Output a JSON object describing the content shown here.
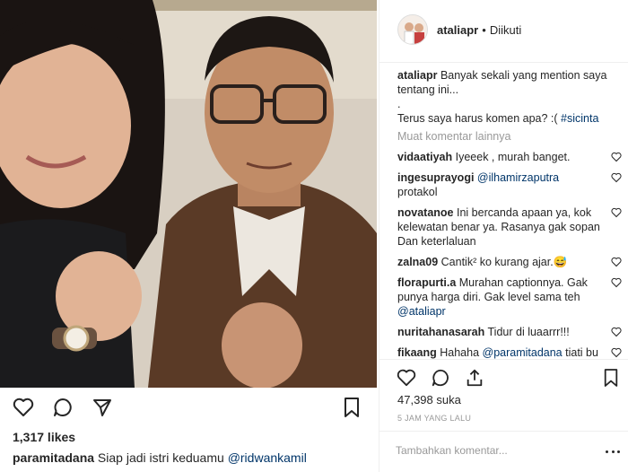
{
  "post_left": {
    "likes": "1,317 likes",
    "caption_user": "paramitadana",
    "caption_text": " Siap jadi istri keduamu ",
    "caption_mention": "@ridwankamil"
  },
  "post_right": {
    "header": {
      "username": "ataliapr",
      "dot": "•",
      "follow_status": "Diikuti"
    },
    "caption": {
      "user": "ataliapr",
      "line1": " Banyak sekali yang mention saya tentang ini...",
      "line2": ".",
      "line3": "Terus saya harus komen apa? :( ",
      "hashtag": "#sicinta"
    },
    "load_more": "Muat komentar lainnya",
    "comments": [
      {
        "user": "vidaatiyah",
        "text": " Iyeeek , murah banget."
      },
      {
        "user": "ingesuprayogi",
        "mention": " @ilhamirzaputra",
        "text": " protakol"
      },
      {
        "user": "novatanoe",
        "text": " Ini bercanda apaan ya, kok kelewatan benar ya. Rasanya gak sopan Dan keterlaluan"
      },
      {
        "user": "zalna09",
        "text": " Cantik² ko kurang ajar.",
        "emoji": "😅"
      },
      {
        "user": "florapurti.a",
        "text": " Murahan captionnya. Gak punya harga diri. Gak level sama teh ",
        "mention": "@ataliapr"
      },
      {
        "user": "nuritahanasarah",
        "text": " Tidur di luaarrr!!!"
      },
      {
        "user": "fikaang",
        "text": " Hahaha ",
        "mention": "@paramitadana",
        "text2": " tiati bu bikin captionnya.. bisa di serbu loh"
      }
    ],
    "likes": "47,398 suka",
    "time": "5 JAM YANG LALU",
    "add_comment_placeholder": "Tambahkan komentar..."
  },
  "colors": {
    "text": "#262626",
    "muted": "#999999",
    "mention": "#003569",
    "border": "#efefef"
  },
  "icons": [
    "heart-icon",
    "comment-icon",
    "share-icon",
    "bookmark-icon",
    "options-icon"
  ]
}
